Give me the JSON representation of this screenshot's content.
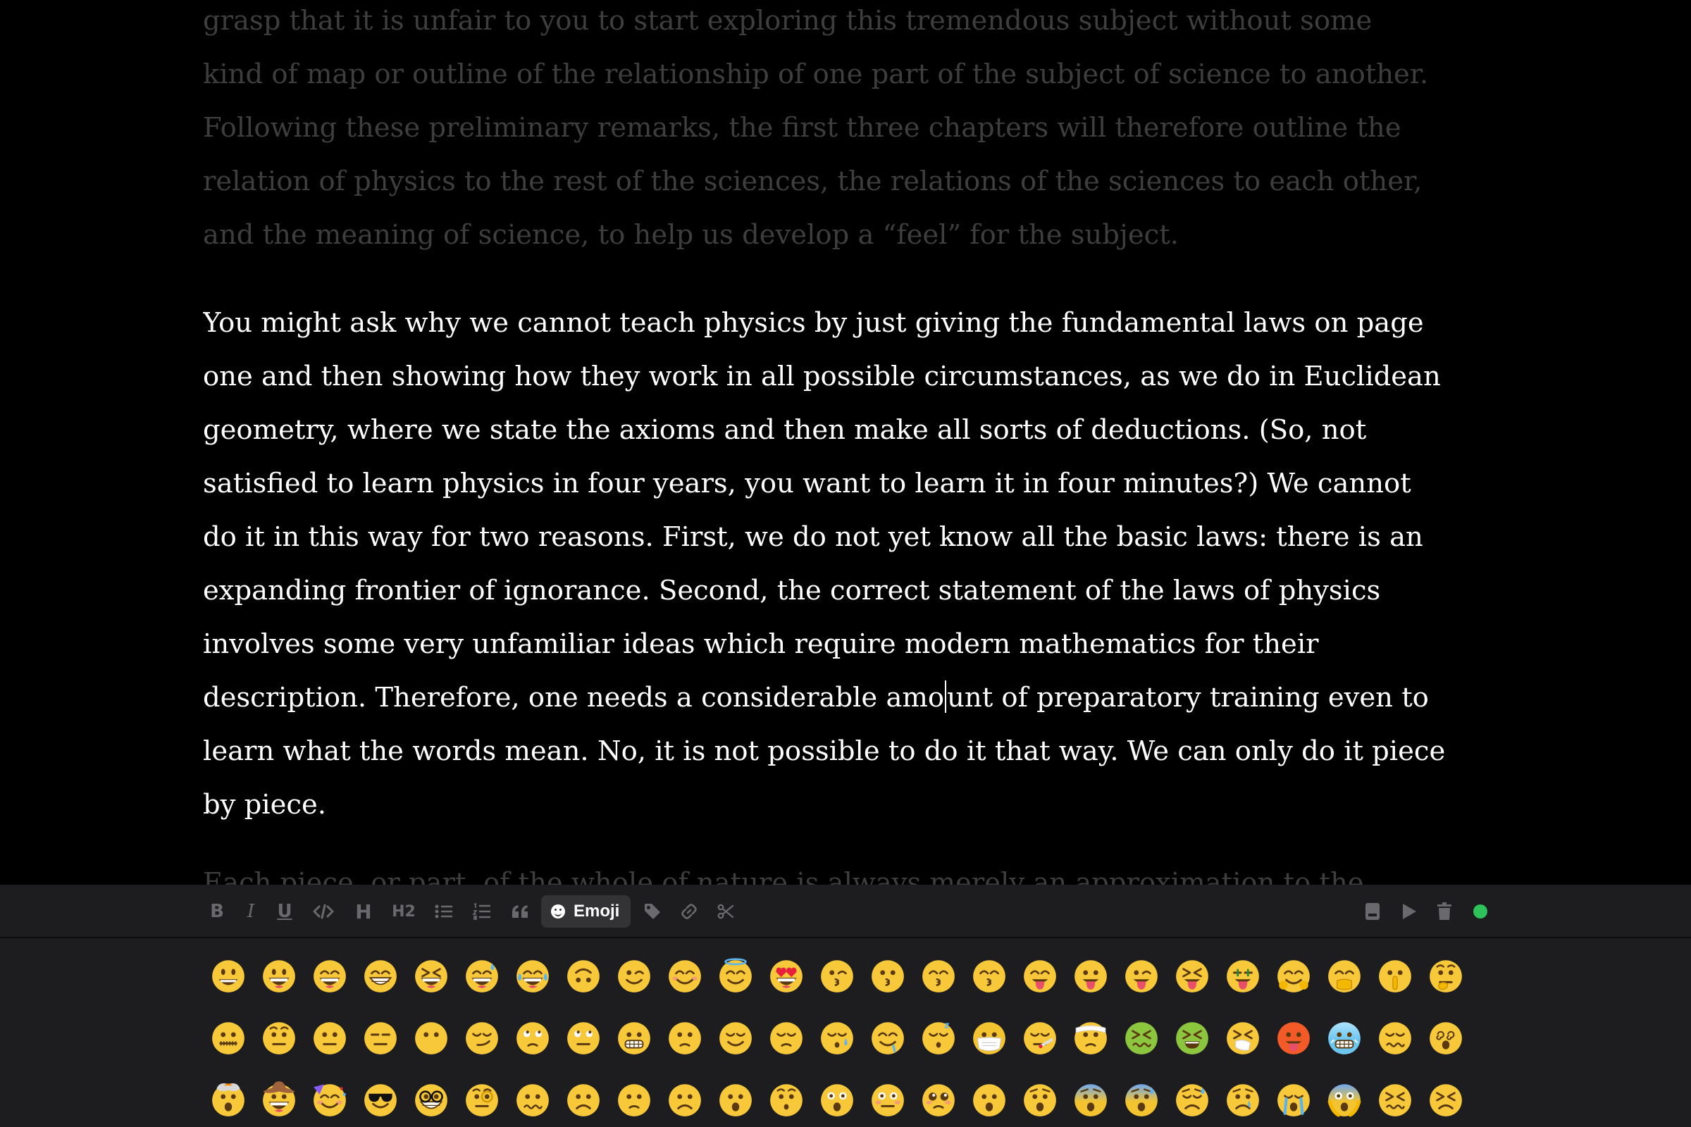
{
  "document": {
    "paragraph_prev": [
      "grasp that it is unfair to you to start exploring this tremendous subject without some",
      "kind of map or outline of the relationship of one part of the subject of science to another.",
      "Following these preliminary remarks, the first three chapters will therefore outline the",
      "relation of physics to the rest of the sciences, the relations of the sciences to each other,",
      "and the meaning of science, to help us develop a “feel” for the subject."
    ],
    "paragraph_active": [
      "You might ask why we cannot teach physics by just giving the fundamental laws on page",
      "one and then showing how they work in all possible circumstances, as we do in Euclidean",
      "geometry, where we state the axioms and then make all sorts of deductions. (So, not",
      "satisfied to learn physics in four years, you want to learn it in four minutes?) We cannot",
      "do it in this way for two reasons. First, we do not yet know all the basic laws: there is an",
      "expanding frontier of ignorance. Second, the correct statement of the laws of physics",
      "involves some very unfamiliar ideas which require modern mathematics for their",
      "learn what the words mean. No, it is not possible to do it that way. We can only do it piece",
      "by piece."
    ],
    "caret_line": {
      "before": "description. Therefore, one needs a considerable amo",
      "after": "unt of preparatory training even to"
    },
    "paragraph_next_partial": "Each piece, or part, of the whole of nature is always merely an approximation to the"
  },
  "toolbar": {
    "bold": "B",
    "italic": "I",
    "underline": "U",
    "heading": "H",
    "heading2": "H2",
    "emoji_label": "Emoji"
  },
  "colors": {
    "background": "#000000",
    "toolbar_bg": "#1d1d1f",
    "active_text": "#ffffff",
    "dim_text": "#3e3e3e",
    "status_dot": "#2fc15a"
  },
  "emoji_rows": [
    [
      "grinning",
      "smiley",
      "smile",
      "grin",
      "laughing",
      "sweat-smile",
      "joy",
      "upside-down",
      "wink",
      "blush",
      "innocent",
      "heart-eyes",
      "kissing-heart",
      "kissing",
      "kissing-closed-eyes",
      "kissing-smiling-eyes",
      "yum",
      "stuck-out-tongue",
      "winking-tongue",
      "squinting-tongue",
      "money-mouth",
      "hugging",
      "hand-over-mouth",
      "shushing",
      "thinking"
    ],
    [
      "zipper-mouth",
      "raised-eyebrow",
      "neutral",
      "expressionless",
      "no-mouth",
      "smirk",
      "unamused",
      "rolling-eyes",
      "grimacing",
      "lying",
      "relieved",
      "pensive",
      "sleepy",
      "drooling",
      "sleeping",
      "mask",
      "thermometer",
      "bandage",
      "nauseated",
      "vomiting",
      "sneezing",
      "hot",
      "cold",
      "woozy",
      "dizzy"
    ],
    [
      "exploding-head",
      "cowboy",
      "partying",
      "sunglasses",
      "nerd",
      "monocle",
      "confused",
      "worried",
      "slightly-frowning",
      "frowning",
      "open-mouth",
      "hushed",
      "astonished",
      "flushed",
      "pleading",
      "frowning-open",
      "anguished",
      "fearful",
      "cold-sweat",
      "disappointed-relieved",
      "crying",
      "sobbing",
      "screaming",
      "confounded",
      "persevering"
    ]
  ]
}
